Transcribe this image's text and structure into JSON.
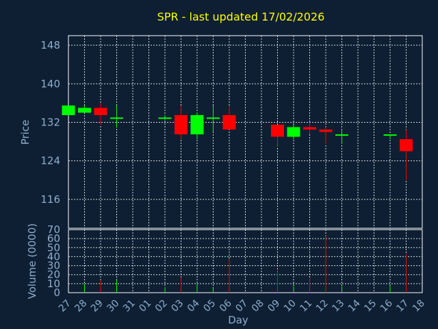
{
  "chart_data": {
    "type": "candlestick",
    "title": "SPR - last updated 17/02/2026",
    "xlabel": "Day",
    "ylabel": "Price",
    "volume_label": "Volume (0000)",
    "x_ticks": [
      "27",
      "28",
      "29",
      "30",
      "31",
      "01",
      "02",
      "03",
      "04",
      "05",
      "06",
      "07",
      "08",
      "09",
      "10",
      "11",
      "12",
      "13",
      "14",
      "15",
      "16",
      "17",
      "18"
    ],
    "price_ylim": [
      110,
      150
    ],
    "price_ticks": [
      116,
      124,
      132,
      140,
      148
    ],
    "volume_ylim": [
      0,
      70
    ],
    "volume_ticks": [
      0,
      10,
      20,
      30,
      40,
      50,
      60,
      70
    ],
    "grid": true,
    "colors": {
      "background": "#0e1f33",
      "title": "#ffff00",
      "axis_text": "#8faecc",
      "up": "#00ff00",
      "down": "#ff0000",
      "frame": "#ffffff",
      "grid": "#ffffff"
    },
    "candles": [
      {
        "day": "27",
        "open": 133.5,
        "close": 135.5,
        "high": 135.5,
        "low": 133.5,
        "volume": 0
      },
      {
        "day": "28",
        "open": 134.0,
        "close": 135.0,
        "high": 135.5,
        "low": 134.0,
        "volume": 10
      },
      {
        "day": "29",
        "open": 135.0,
        "close": 133.5,
        "high": 136.0,
        "low": 131.5,
        "volume": 14
      },
      {
        "day": "30",
        "open": 133.0,
        "close": 133.0,
        "high": 135.5,
        "low": 131.0,
        "volume": 14
      },
      {
        "day": "02",
        "open": 133.0,
        "close": 133.0,
        "high": 133.5,
        "low": 132.5,
        "volume": 6
      },
      {
        "day": "03",
        "open": 133.5,
        "close": 129.5,
        "high": 135.5,
        "low": 128.5,
        "volume": 17
      },
      {
        "day": "04",
        "open": 129.5,
        "close": 133.5,
        "high": 134.0,
        "low": 128.5,
        "volume": 10
      },
      {
        "day": "05",
        "open": 133.0,
        "close": 133.0,
        "high": 135.5,
        "low": 130.0,
        "volume": 5
      },
      {
        "day": "06",
        "open": 133.5,
        "close": 130.5,
        "high": 135.5,
        "low": 130.5,
        "volume": 38
      },
      {
        "day": "09",
        "open": 131.5,
        "close": 129.0,
        "high": 131.5,
        "low": 127.0,
        "volume": 24
      },
      {
        "day": "10",
        "open": 129.0,
        "close": 131.0,
        "high": 131.5,
        "low": 128.5,
        "volume": 7
      },
      {
        "day": "11",
        "open": 131.0,
        "close": 130.5,
        "high": 132.0,
        "low": 129.5,
        "volume": 15
      },
      {
        "day": "12",
        "open": 130.5,
        "close": 130.0,
        "high": 131.0,
        "low": 127.5,
        "volume": 63
      },
      {
        "day": "13",
        "open": 129.5,
        "close": 129.5,
        "high": 130.5,
        "low": 127.5,
        "volume": 7
      },
      {
        "day": "16",
        "open": 129.5,
        "close": 129.5,
        "high": 129.5,
        "low": 128.5,
        "volume": 8
      },
      {
        "day": "17",
        "open": 128.5,
        "close": 126.0,
        "high": 130.5,
        "low": 120.0,
        "volume": 43
      }
    ]
  }
}
